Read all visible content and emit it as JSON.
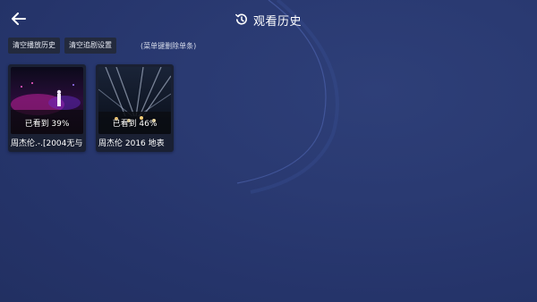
{
  "header": {
    "title": "观看历史",
    "back_icon": "back-arrow-icon",
    "title_icon": "history-icon"
  },
  "toolbar": {
    "clear_history_label": "清空播放历史",
    "clear_follow_label": "清空追剧设置",
    "hint": "(菜单键删除单条)"
  },
  "colors": {
    "background": "#27366c",
    "button_bg": "#232a3d",
    "card_bg": "#1a2033"
  },
  "history": [
    {
      "progress_text": "已看到 39%",
      "progress": 0.39,
      "title": "周杰伦.-.[2004无与"
    },
    {
      "progress_text": "已看到 46%",
      "progress": 0.46,
      "title": "周杰伦 2016 地表"
    }
  ]
}
